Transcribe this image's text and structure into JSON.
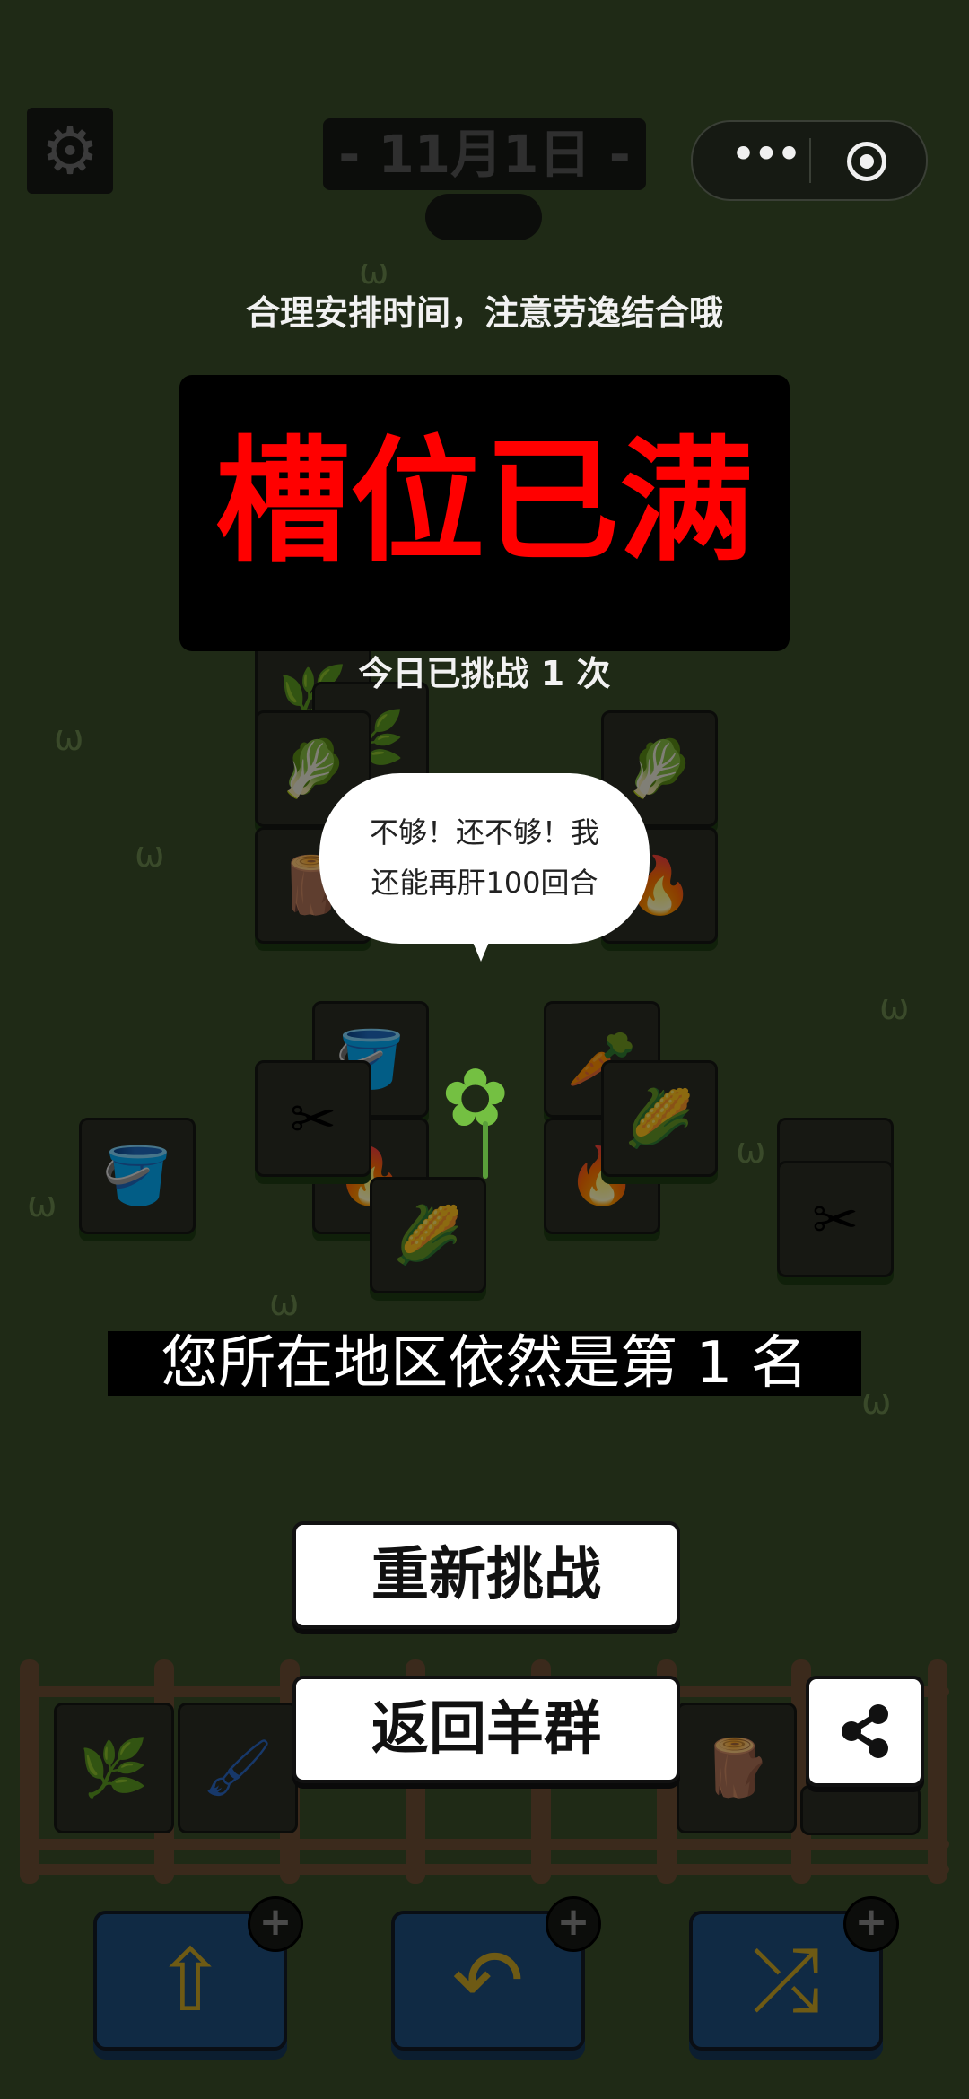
{
  "header": {
    "settings_icon": "gear-icon",
    "date": "- 11月1日 -",
    "more_icon": "more-dots-icon",
    "close_icon": "target-icon"
  },
  "hint": "合理安排时间，注意劳逸结合哦",
  "result_panel": {
    "title": "槽位已满",
    "title_color": "#ff0000",
    "attempts": "今日已挑战 1 次"
  },
  "speech_bubble": {
    "line1": "不够！还不够！我",
    "line2": "还能再肝100回合"
  },
  "rank_text": "您所在地区依然是第 1 名",
  "buttons": {
    "retry": "重新挑战",
    "back": "返回羊群",
    "share_icon": "share-icon"
  },
  "tools": [
    {
      "icon": "move-out-icon",
      "plus": "+"
    },
    {
      "icon": "undo-icon",
      "plus": "+"
    },
    {
      "icon": "shuffle-icon",
      "plus": "+"
    }
  ],
  "colors": {
    "background": "#1f2a16",
    "tool_blue": "#102a44"
  }
}
